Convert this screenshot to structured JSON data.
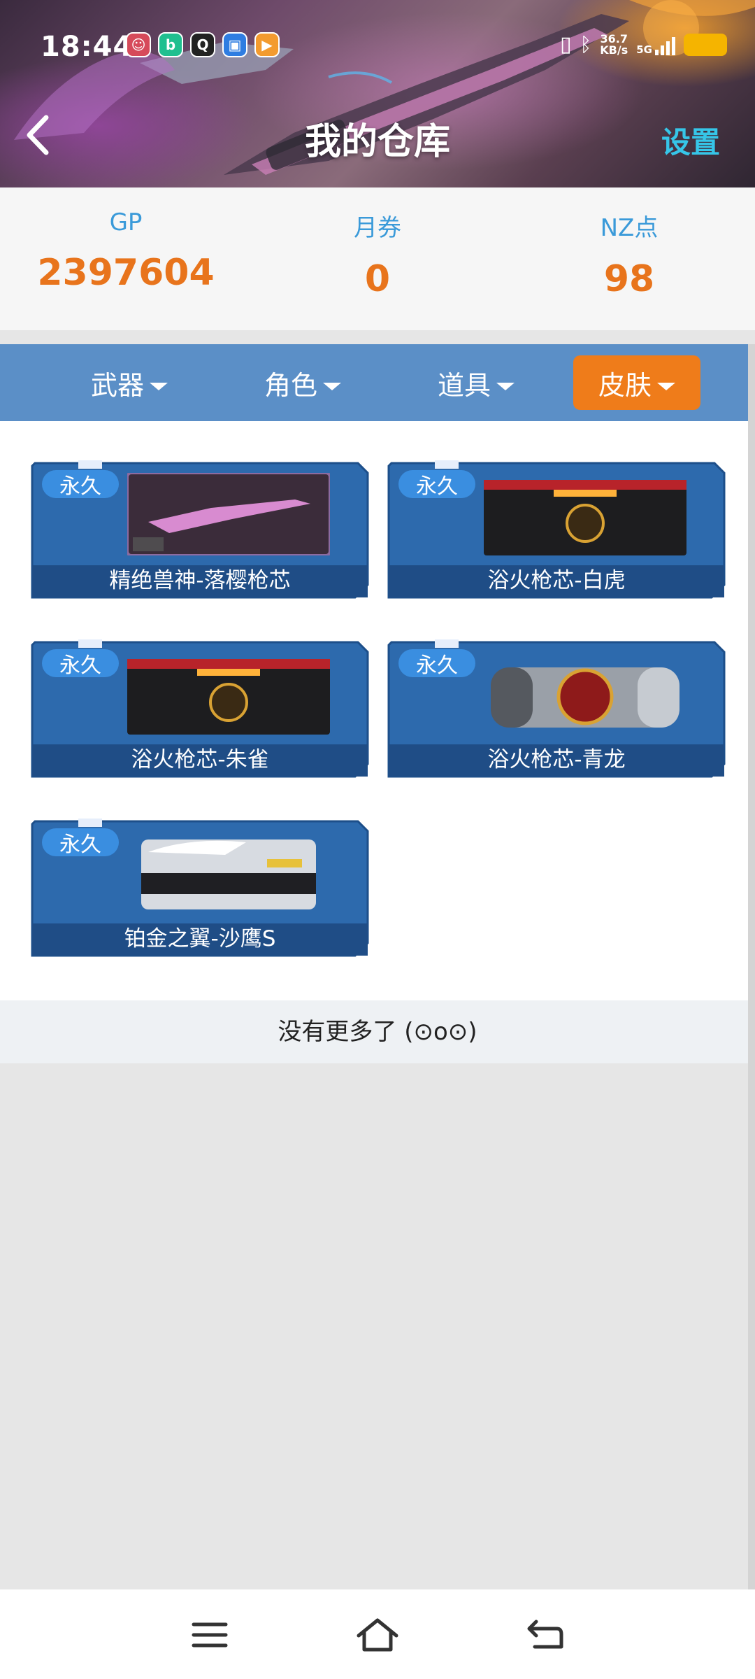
{
  "status_bar": {
    "time": "18:44",
    "net_speed_value": "36.7",
    "net_speed_unit": "KB/s",
    "network_type": "5G",
    "app_icons": [
      "avatar-app-icon",
      "bilibili-icon",
      "qq-icon",
      "message-app-icon",
      "video-app-icon"
    ],
    "battery_color": "#f5b400"
  },
  "header": {
    "title": "我的仓库",
    "settings_label": "设置",
    "back_icon": "chevron-left-icon"
  },
  "currency": [
    {
      "label": "GP",
      "value": "2397604"
    },
    {
      "label": "月券",
      "value": "0"
    },
    {
      "label": "NZ点",
      "value": "98"
    }
  ],
  "tabs": [
    {
      "label": "武器",
      "active": false
    },
    {
      "label": "角色",
      "active": false
    },
    {
      "label": "道具",
      "active": false
    },
    {
      "label": "皮肤",
      "active": true
    }
  ],
  "items": [
    {
      "badge": "永久",
      "name": "精绝兽神-落樱枪芯",
      "image": "pink-rifle-card"
    },
    {
      "badge": "永久",
      "name": "浴火枪芯-白虎",
      "image": "black-crate"
    },
    {
      "badge": "永久",
      "name": "浴火枪芯-朱雀",
      "image": "black-crate"
    },
    {
      "badge": "永久",
      "name": "浴火枪芯-青龙",
      "image": "silver-cylinder"
    },
    {
      "badge": "永久",
      "name": "铂金之翼-沙鹰S",
      "image": "silver-crate"
    }
  ],
  "list_end_text": "没有更多了 (⊙o⊙)",
  "navbar": {
    "items": [
      "menu-icon",
      "home-icon",
      "back-icon"
    ]
  },
  "colors": {
    "accent_orange": "#ef7c1a",
    "value_orange": "#e8741c",
    "label_blue": "#3a9ad9",
    "tab_bar_blue": "#5b8fc7",
    "settings_cyan": "#36c6e8",
    "card_blue": "#2d6aad"
  }
}
